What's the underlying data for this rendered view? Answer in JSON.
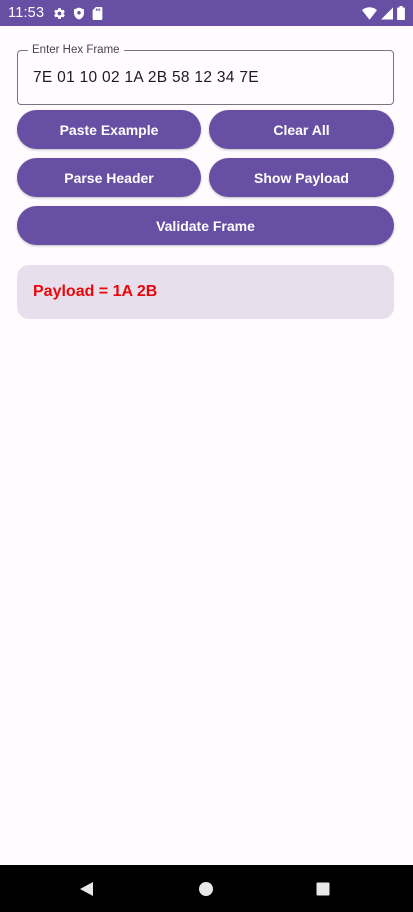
{
  "status_bar": {
    "time": "11:53",
    "left_icons": [
      "gear-icon",
      "shield-icon",
      "sd-card-icon"
    ],
    "right_icons": [
      "wifi-icon",
      "cell-signal-icon",
      "battery-icon"
    ],
    "background": "#6750A4"
  },
  "input": {
    "label": "Enter Hex Frame",
    "value": "7E 01 10 02 1A 2B 58 12 34 7E"
  },
  "buttons": {
    "paste_example": "Paste Example",
    "clear_all": "Clear All",
    "parse_header": "Parse Header",
    "show_payload": "Show Payload",
    "validate_frame": "Validate Frame",
    "color": "#6750A4"
  },
  "result": {
    "text": "Payload = 1A 2B",
    "text_color": "#E8080C",
    "background": "#E7E0EC"
  },
  "nav_bar": {
    "buttons": [
      "back-icon",
      "home-icon",
      "recents-icon"
    ]
  }
}
